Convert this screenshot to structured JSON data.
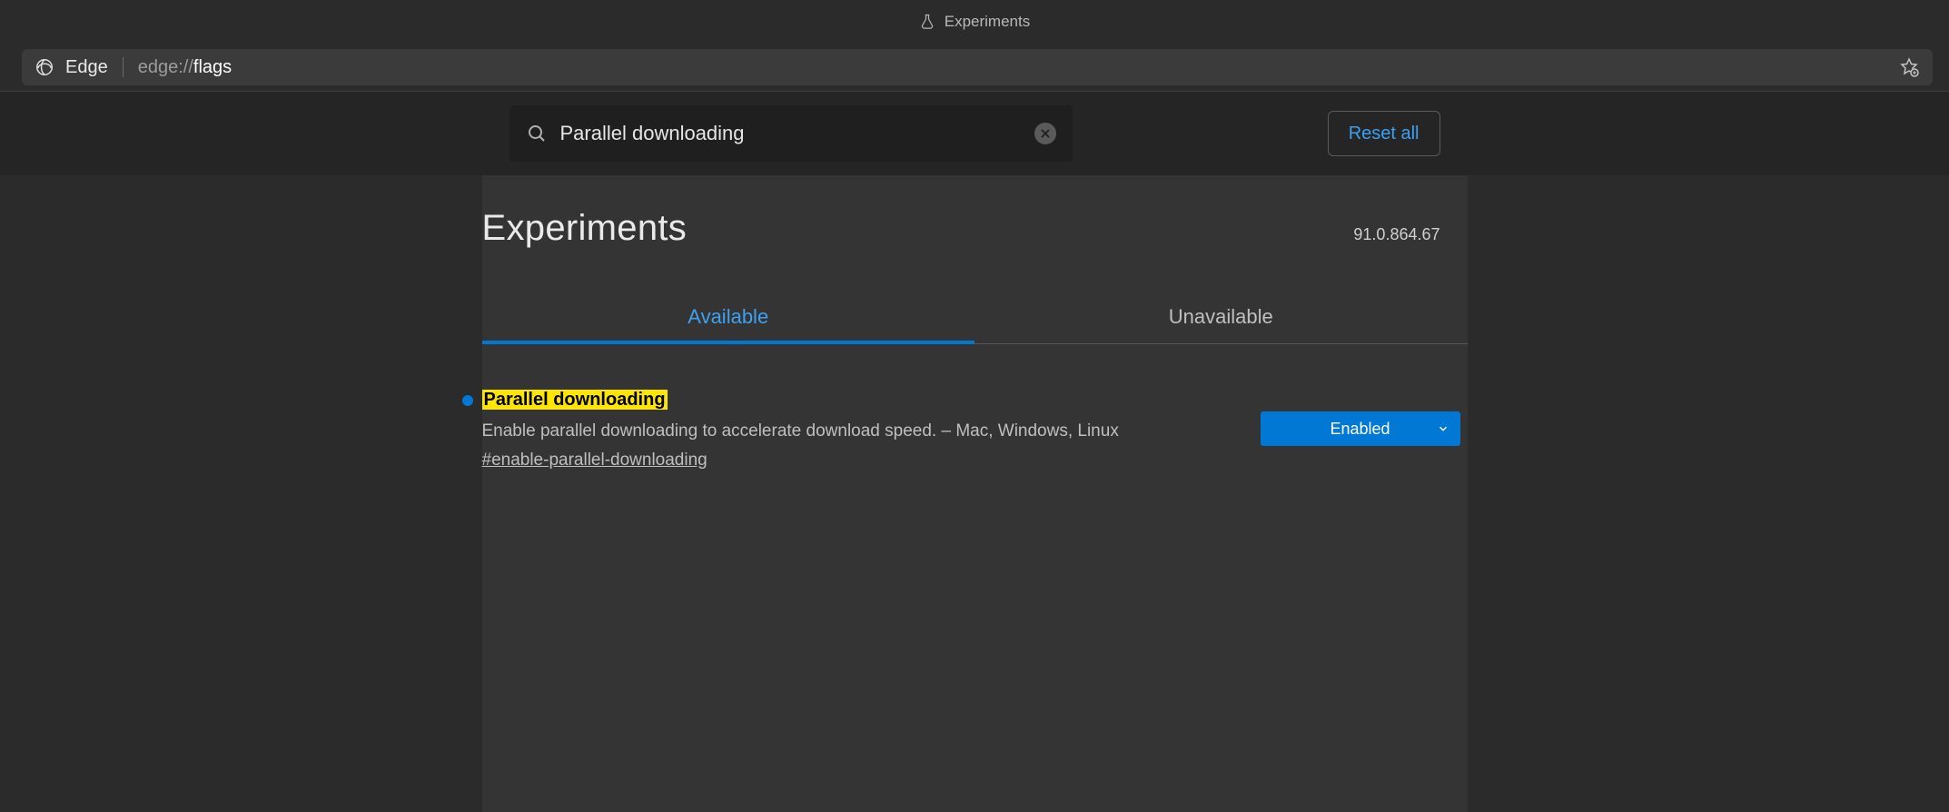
{
  "tab": {
    "title": "Experiments"
  },
  "address": {
    "browser_label": "Edge",
    "scheme": "edge://",
    "path": "flags"
  },
  "header": {
    "search_value": "Parallel downloading",
    "reset_label": "Reset all"
  },
  "page": {
    "title": "Experiments",
    "version": "91.0.864.67",
    "tabs": {
      "available": "Available",
      "unavailable": "Unavailable"
    }
  },
  "flags": [
    {
      "title": "Parallel downloading",
      "description": "Enable parallel downloading to accelerate download speed. – Mac, Windows, Linux",
      "anchor": "#enable-parallel-downloading",
      "state": "Enabled"
    }
  ]
}
